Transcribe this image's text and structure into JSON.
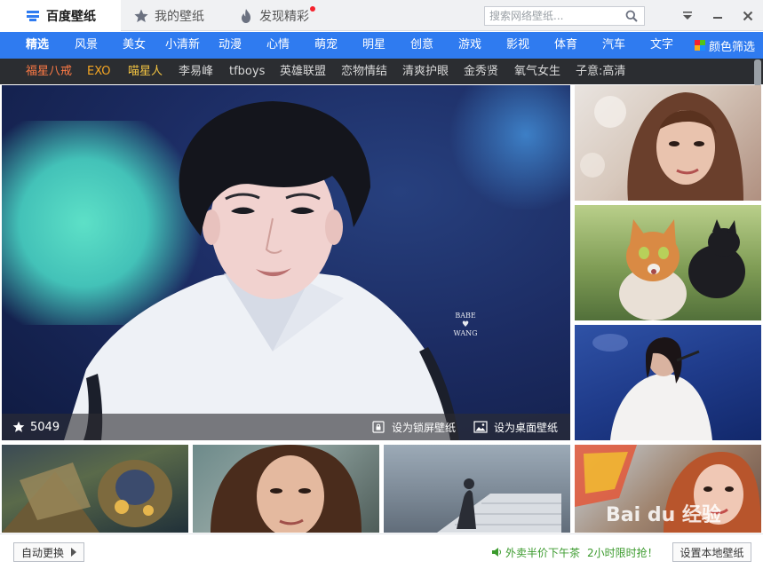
{
  "titlebar": {
    "tabs": [
      {
        "label": "百度壁纸",
        "active": true
      },
      {
        "label": "我的壁纸",
        "active": false
      },
      {
        "label": "发现精彩",
        "active": false,
        "badge": "red-dot"
      }
    ],
    "search": {
      "placeholder": "搜索网络壁纸..."
    },
    "icons": {
      "search": "search-icon",
      "menu": "dropdown-menu-icon",
      "minimize": "minimize-icon",
      "close": "close-icon"
    }
  },
  "categories": {
    "items": [
      "精选",
      "风景",
      "美女",
      "小清新",
      "动漫",
      "心情",
      "萌宠",
      "明星",
      "创意",
      "游戏",
      "影视",
      "体育",
      "汽车",
      "文字"
    ],
    "active": "精选",
    "color_filter": "颜色筛选"
  },
  "tags": [
    {
      "label": "福星八戒",
      "color": "#ff7a45"
    },
    {
      "label": "EXO",
      "color": "#f5a623"
    },
    {
      "label": "喵星人",
      "color": "#f5c542"
    },
    {
      "label": "李易峰",
      "color": "#d9d9d9"
    },
    {
      "label": "tfboys",
      "color": "#d9d9d9"
    },
    {
      "label": "英雄联盟",
      "color": "#d9d9d9"
    },
    {
      "label": "恋物情结",
      "color": "#d9d9d9"
    },
    {
      "label": "清爽护眼",
      "color": "#d9d9d9"
    },
    {
      "label": "金秀贤",
      "color": "#d9d9d9"
    },
    {
      "label": "氧气女生",
      "color": "#d9d9d9"
    },
    {
      "label": "子意:高清",
      "color": "#d9d9d9"
    }
  ],
  "featured": {
    "likes": "5049",
    "watermark": {
      "line1": "BABE",
      "line2": "WANG"
    },
    "set_lockscreen": "设为锁屏壁纸",
    "set_desktop": "设为桌面壁纸"
  },
  "footer": {
    "auto_change": "自动更换",
    "promo_1": "外卖半价下午茶",
    "promo_2": "2小时限时抢！",
    "set_local": "设置本地壁纸"
  },
  "overlay_watermark": "Bai du 经验",
  "colors": {
    "accent": "#2f7bf0",
    "tagbar": "#2b2d31",
    "promo": "#3a9a2c"
  }
}
